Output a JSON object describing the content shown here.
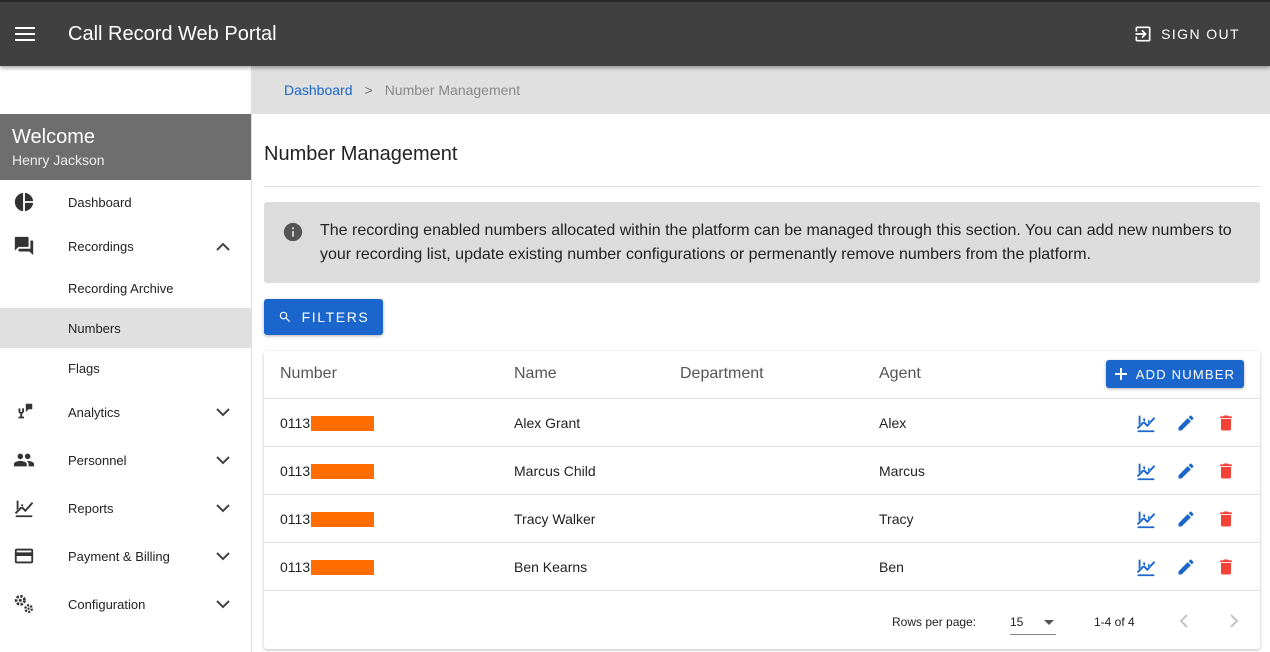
{
  "app": {
    "title": "Call Record Web Portal",
    "signout_label": "SIGN OUT",
    "accent": "#1a66cc",
    "appbar_color": "#404040"
  },
  "sidebar": {
    "welcome_title": "Welcome",
    "user_name": "Henry Jackson",
    "items": [
      {
        "label": "Dashboard",
        "icon": "pie-chart-icon"
      },
      {
        "label": "Recordings",
        "icon": "forum-icon",
        "expanded": true,
        "children": [
          {
            "label": "Recording Archive"
          },
          {
            "label": "Numbers",
            "active": true
          },
          {
            "label": "Flags"
          }
        ]
      },
      {
        "label": "Analytics",
        "icon": "record-voice-icon"
      },
      {
        "label": "Personnel",
        "icon": "people-icon"
      },
      {
        "label": "Reports",
        "icon": "trend-chart-icon"
      },
      {
        "label": "Payment & Billing",
        "icon": "credit-card-icon"
      },
      {
        "label": "Configuration",
        "icon": "gears-icon"
      }
    ]
  },
  "breadcrumb": {
    "link": "Dashboard",
    "separator": ">",
    "current": "Number Management"
  },
  "main": {
    "title": "Number Management",
    "info_text": "The recording enabled numbers allocated within the platform can be managed through this section. You can add new numbers to your recording list, update existing number configurations or permenantly remove numbers from the platform.",
    "filters_label": "FILTERS",
    "add_label": "ADD NUMBER",
    "columns": [
      "Number",
      "Name",
      "Department",
      "Agent"
    ],
    "rows": [
      {
        "number_prefix": "0113",
        "name": "Alex Grant",
        "department": "",
        "agent": "Alex"
      },
      {
        "number_prefix": "0113",
        "name": "Marcus Child",
        "department": "",
        "agent": "Marcus"
      },
      {
        "number_prefix": "0113",
        "name": "Tracy Walker",
        "department": "",
        "agent": "Tracy"
      },
      {
        "number_prefix": "0113",
        "name": "Ben Kearns",
        "department": "",
        "agent": "Ben"
      }
    ],
    "footer": {
      "rows_per_page_label": "Rows per page:",
      "rows_per_page_value": "15",
      "range": "1-4 of 4"
    },
    "redaction_color": "#ff6d00",
    "delete_color": "#f44336"
  }
}
